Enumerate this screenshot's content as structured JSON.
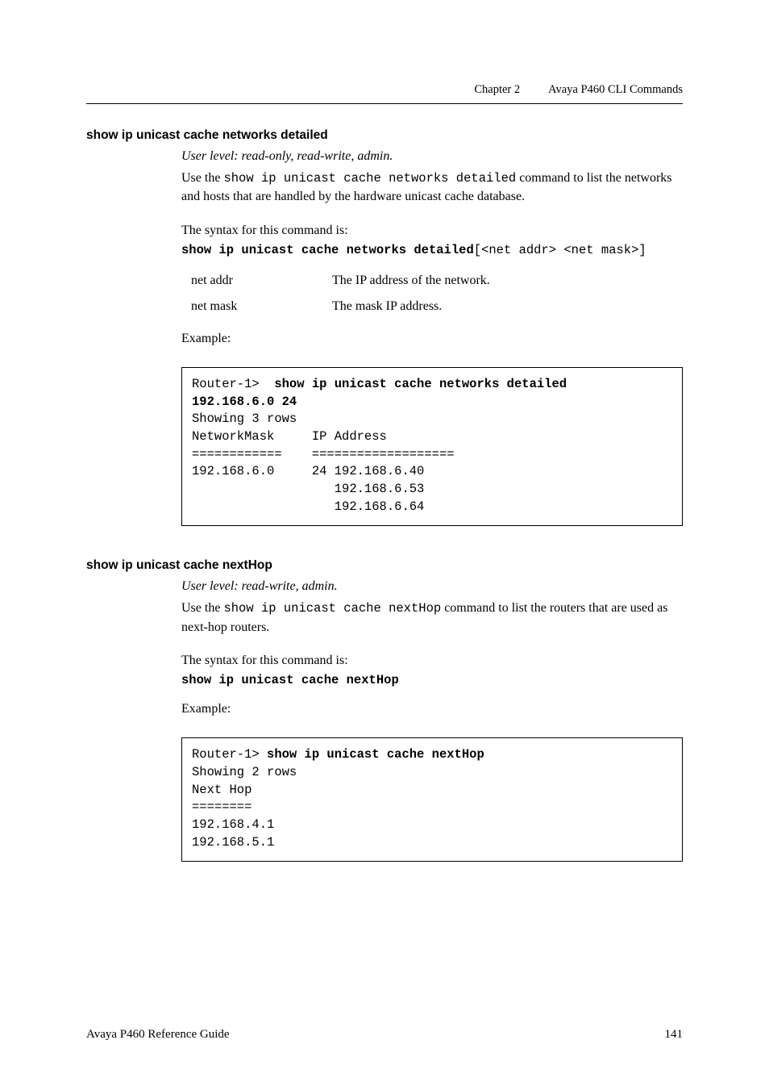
{
  "header": {
    "chapter": "Chapter 2",
    "title": "Avaya P460 CLI Commands"
  },
  "section1": {
    "heading": "show ip unicast cache networks detailed",
    "userlevel": "User level: read-only, read-write, admin.",
    "para_prefix": "Use the ",
    "para_cmd": "show ip unicast cache networks detailed",
    "para_suffix": " command to list the networks and hosts that are handled by the hardware unicast cache database.",
    "syntax_intro": "The syntax for this command is:",
    "syntax_bold": "show ip unicast cache networks detailed",
    "syntax_tail": "[<net addr> <net mask>]",
    "params": [
      {
        "name": "net addr",
        "desc": "The IP address of the network."
      },
      {
        "name": "net mask",
        "desc": "The mask IP address."
      }
    ],
    "example_label": "Example:",
    "code_l1_prompt": "Router-1>  ",
    "code_l1_bold": "show ip unicast cache networks detailed",
    "code_l2_bold": "192.168.6.0 24",
    "code_l3": "Showing 3 rows",
    "code_l4": "NetworkMask     IP Address",
    "code_l5": "============    ===================",
    "code_l6": "192.168.6.0     24 192.168.6.40",
    "code_l7": "                   192.168.6.53",
    "code_l8": "                   192.168.6.64"
  },
  "section2": {
    "heading": "show ip unicast cache nextHop",
    "userlevel": "User level: read-write, admin.",
    "para_prefix": "Use the ",
    "para_cmd": "show ip unicast cache nextHop",
    "para_suffix": " command to list the routers that are used as next-hop routers.",
    "syntax_intro": "The syntax for this command is:",
    "syntax_bold": "show ip unicast cache nextHop",
    "example_label": "Example:",
    "code_l1_prompt": "Router-1> ",
    "code_l1_bold": "show ip unicast cache nextHop",
    "code_l2": "Showing 2 rows",
    "code_l3": "Next Hop",
    "code_l4": "========",
    "code_l5": "192.168.4.1",
    "code_l6": "192.168.5.1"
  },
  "footer": {
    "left": "Avaya P460 Reference Guide",
    "right": "141"
  }
}
